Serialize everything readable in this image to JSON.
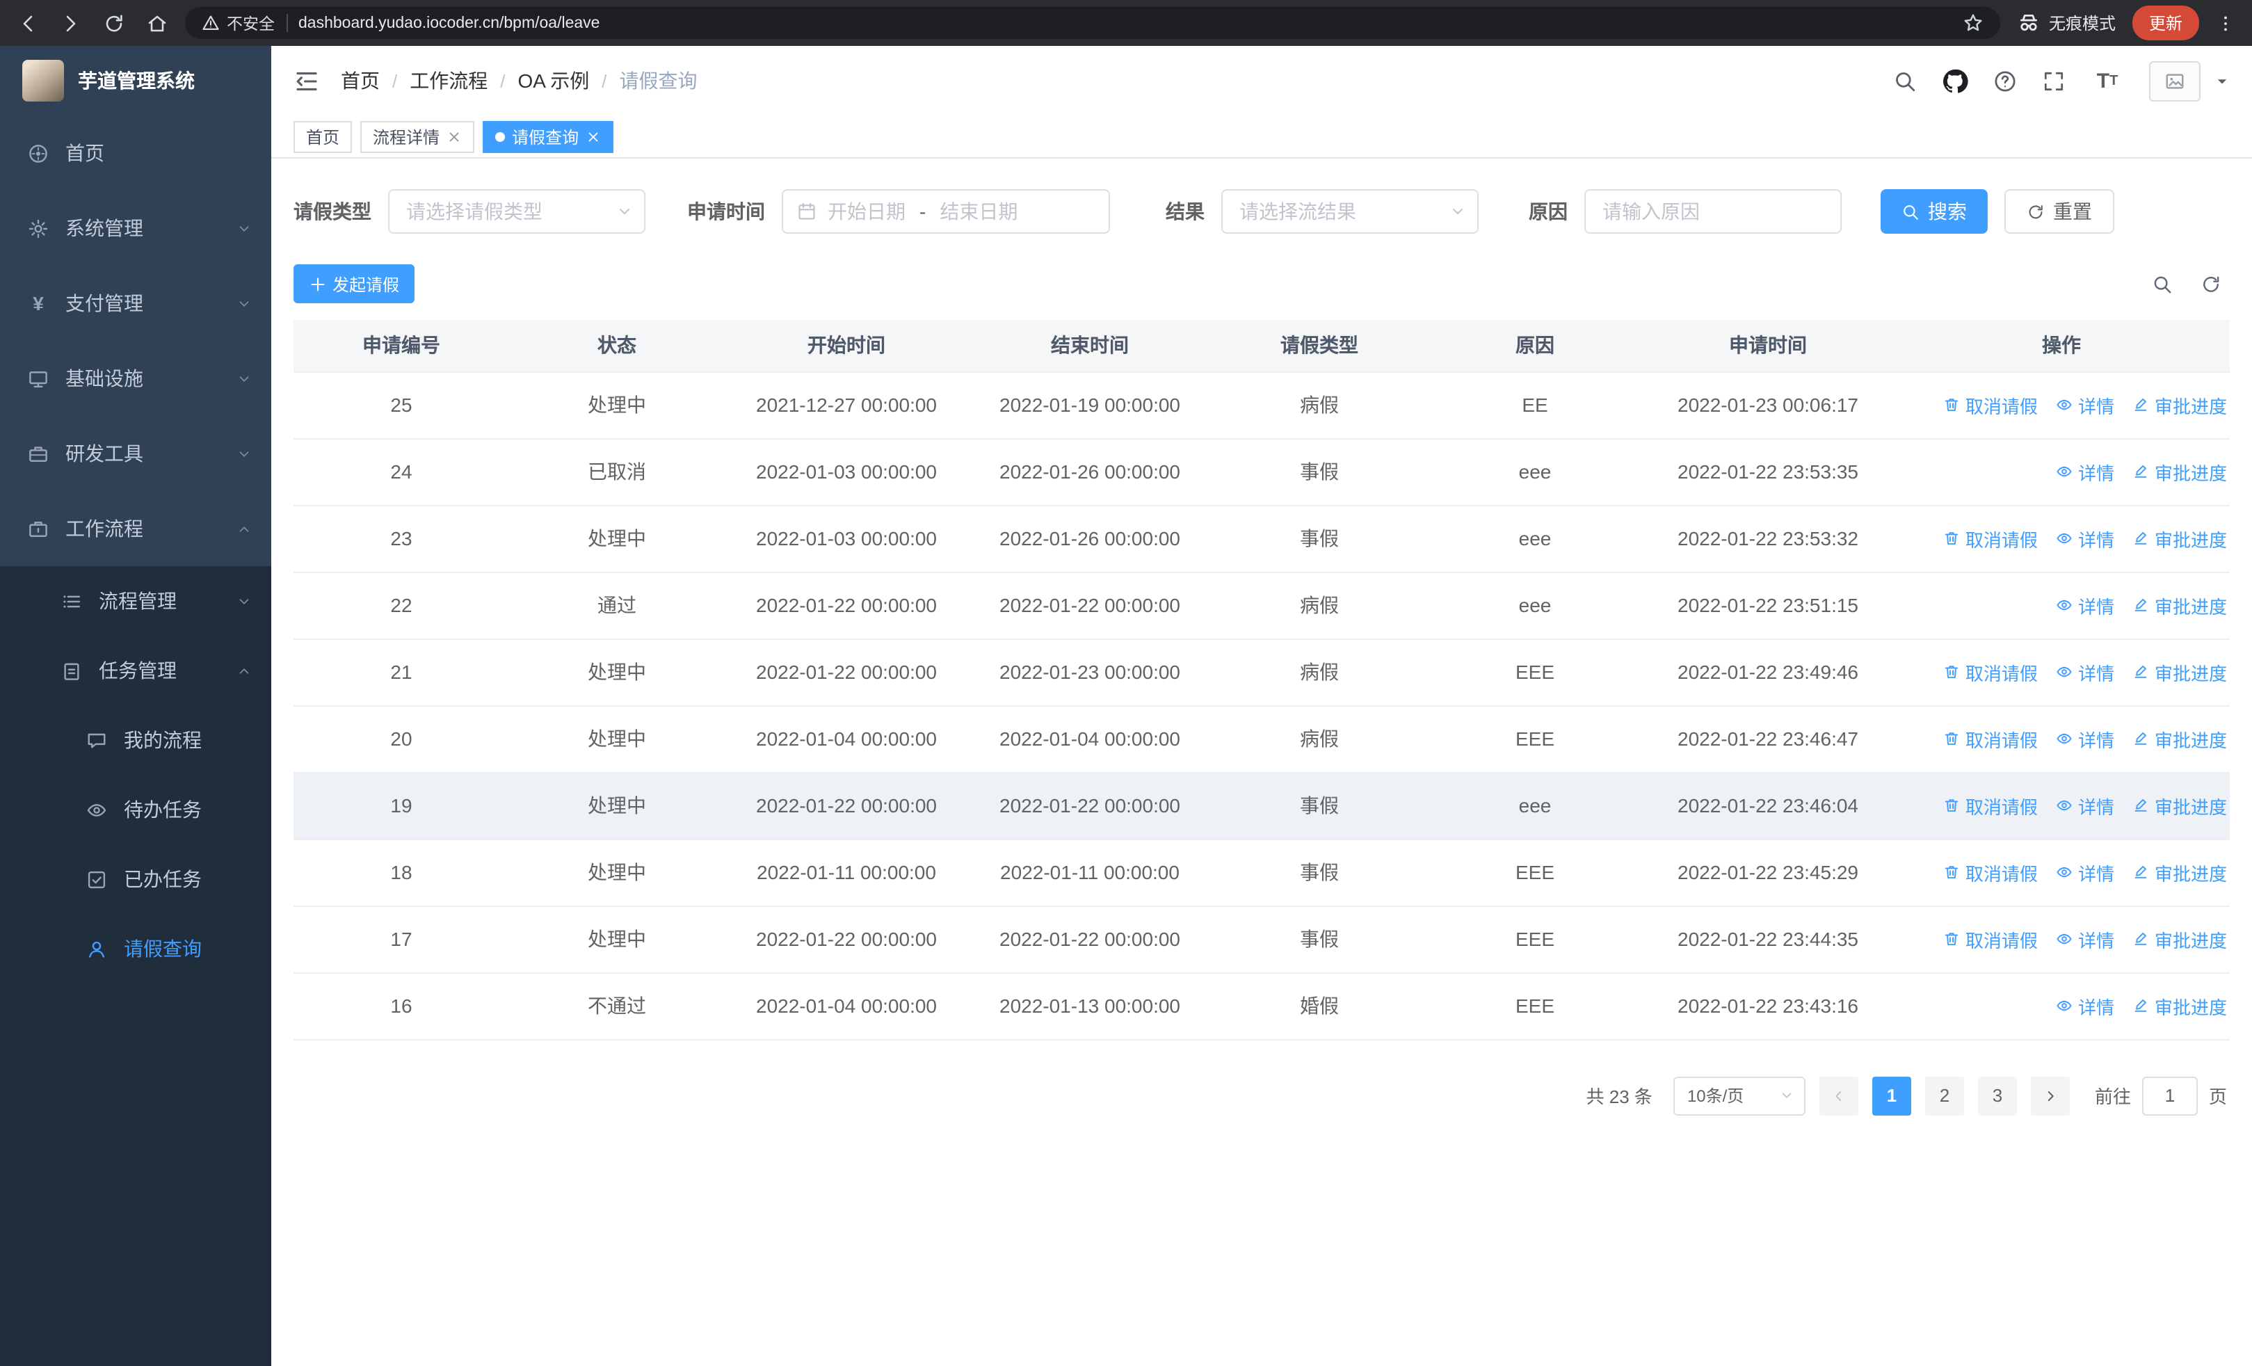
{
  "browser": {
    "url": "dashboard.yudao.iocoder.cn/bpm/oa/leave",
    "security_label": "不安全",
    "incognito_label": "无痕模式",
    "update_label": "更新"
  },
  "colors": {
    "accent": "#409eff",
    "sidebar_bg": "#304156",
    "submenu_bg": "#1f2d3d"
  },
  "sidebar": {
    "logo_title": "芋道管理系统",
    "items": [
      {
        "key": "home",
        "label": "首页",
        "icon": "dashboard-icon",
        "level": 1
      },
      {
        "key": "system",
        "label": "系统管理",
        "icon": "gear-icon",
        "level": 1,
        "chevron": "down"
      },
      {
        "key": "payment",
        "label": "支付管理",
        "icon": "yen-icon",
        "level": 1,
        "chevron": "down"
      },
      {
        "key": "infra",
        "label": "基础设施",
        "icon": "monitor-icon",
        "level": 1,
        "chevron": "down"
      },
      {
        "key": "devtools",
        "label": "研发工具",
        "icon": "toolbox-icon",
        "level": 1,
        "chevron": "down"
      },
      {
        "key": "workflow",
        "label": "工作流程",
        "icon": "briefcase-icon",
        "level": 1,
        "chevron": "up"
      },
      {
        "key": "process-mgmt",
        "label": "流程管理",
        "icon": "list-icon",
        "level": 2,
        "chevron": "down"
      },
      {
        "key": "task-mgmt",
        "label": "任务管理",
        "icon": "clipboard-icon",
        "level": 2,
        "chevron": "up"
      },
      {
        "key": "my-process",
        "label": "我的流程",
        "icon": "chat-icon",
        "level": 3
      },
      {
        "key": "todo-task",
        "label": "待办任务",
        "icon": "eye-icon",
        "level": 3
      },
      {
        "key": "done-task",
        "label": "已办任务",
        "icon": "check-square-icon",
        "level": 3
      },
      {
        "key": "leave-query",
        "label": "请假查询",
        "icon": "user-icon",
        "level": 3,
        "active": true
      }
    ]
  },
  "breadcrumb": {
    "separator": "/",
    "items": [
      "首页",
      "工作流程",
      "OA 示例",
      "请假查询"
    ]
  },
  "tabs": [
    {
      "label": "首页",
      "closable": false,
      "active": false
    },
    {
      "label": "流程详情",
      "closable": true,
      "active": false
    },
    {
      "label": "请假查询",
      "closable": true,
      "active": true
    }
  ],
  "filters": {
    "leave_type_label": "请假类型",
    "leave_type_placeholder": "请选择请假类型",
    "apply_time_label": "申请时间",
    "start_placeholder": "开始日期",
    "range_separator": "-",
    "end_placeholder": "结束日期",
    "result_label": "结果",
    "result_placeholder": "请选择流结果",
    "reason_label": "原因",
    "reason_placeholder": "请输入原因",
    "search_label": "搜索",
    "reset_label": "重置"
  },
  "toolbar": {
    "create_label": "发起请假"
  },
  "table": {
    "columns": [
      "申请编号",
      "状态",
      "开始时间",
      "结束时间",
      "请假类型",
      "原因",
      "申请时间",
      "操作"
    ],
    "action_labels": {
      "cancel": "取消请假",
      "detail": "详情",
      "progress": "审批进度"
    },
    "rows": [
      {
        "id": "25",
        "status": "处理中",
        "start": "2021-12-27 00:00:00",
        "end": "2022-01-19 00:00:00",
        "type": "病假",
        "reason": "EE",
        "applied": "2022-01-23 00:06:17",
        "actions": [
          "cancel",
          "detail",
          "progress"
        ],
        "highlight": false
      },
      {
        "id": "24",
        "status": "已取消",
        "start": "2022-01-03 00:00:00",
        "end": "2022-01-26 00:00:00",
        "type": "事假",
        "reason": "eee",
        "applied": "2022-01-22 23:53:35",
        "actions": [
          "detail",
          "progress"
        ],
        "highlight": false
      },
      {
        "id": "23",
        "status": "处理中",
        "start": "2022-01-03 00:00:00",
        "end": "2022-01-26 00:00:00",
        "type": "事假",
        "reason": "eee",
        "applied": "2022-01-22 23:53:32",
        "actions": [
          "cancel",
          "detail",
          "progress"
        ],
        "highlight": false
      },
      {
        "id": "22",
        "status": "通过",
        "start": "2022-01-22 00:00:00",
        "end": "2022-01-22 00:00:00",
        "type": "病假",
        "reason": "eee",
        "applied": "2022-01-22 23:51:15",
        "actions": [
          "detail",
          "progress"
        ],
        "highlight": false
      },
      {
        "id": "21",
        "status": "处理中",
        "start": "2022-01-22 00:00:00",
        "end": "2022-01-23 00:00:00",
        "type": "病假",
        "reason": "EEE",
        "applied": "2022-01-22 23:49:46",
        "actions": [
          "cancel",
          "detail",
          "progress"
        ],
        "highlight": false
      },
      {
        "id": "20",
        "status": "处理中",
        "start": "2022-01-04 00:00:00",
        "end": "2022-01-04 00:00:00",
        "type": "病假",
        "reason": "EEE",
        "applied": "2022-01-22 23:46:47",
        "actions": [
          "cancel",
          "detail",
          "progress"
        ],
        "highlight": false
      },
      {
        "id": "19",
        "status": "处理中",
        "start": "2022-01-22 00:00:00",
        "end": "2022-01-22 00:00:00",
        "type": "事假",
        "reason": "eee",
        "applied": "2022-01-22 23:46:04",
        "actions": [
          "cancel",
          "detail",
          "progress"
        ],
        "highlight": true
      },
      {
        "id": "18",
        "status": "处理中",
        "start": "2022-01-11 00:00:00",
        "end": "2022-01-11 00:00:00",
        "type": "事假",
        "reason": "EEE",
        "applied": "2022-01-22 23:45:29",
        "actions": [
          "cancel",
          "detail",
          "progress"
        ],
        "highlight": false
      },
      {
        "id": "17",
        "status": "处理中",
        "start": "2022-01-22 00:00:00",
        "end": "2022-01-22 00:00:00",
        "type": "事假",
        "reason": "EEE",
        "applied": "2022-01-22 23:44:35",
        "actions": [
          "cancel",
          "detail",
          "progress"
        ],
        "highlight": false
      },
      {
        "id": "16",
        "status": "不通过",
        "start": "2022-01-04 00:00:00",
        "end": "2022-01-13 00:00:00",
        "type": "婚假",
        "reason": "EEE",
        "applied": "2022-01-22 23:43:16",
        "actions": [
          "detail",
          "progress"
        ],
        "highlight": false
      }
    ]
  },
  "pagination": {
    "total_label": "共 23 条",
    "page_size": "10条/页",
    "pages": [
      "1",
      "2",
      "3"
    ],
    "active_page": "1",
    "goto_label": "前往",
    "goto_value": "1",
    "page_unit_label": "页"
  }
}
